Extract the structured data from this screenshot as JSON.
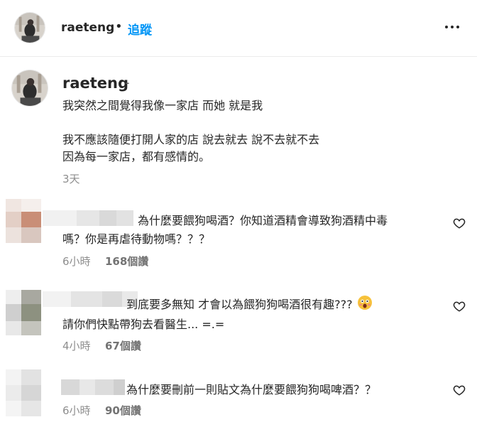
{
  "header": {
    "username": "raeteng",
    "separator": "•",
    "follow_label": "追蹤"
  },
  "post": {
    "username": "raeteng",
    "suffix": "-",
    "caption_lines": [
      "我突然之間覺得我像一家店 而她 就是我",
      "我不應該隨便打開人家的店 說去就去 說不去就不去",
      "因為每一家店，都有感情的。"
    ],
    "time": "3天"
  },
  "comments": [
    {
      "text_lines": [
        "為什麼要餵狗喝酒？你知道酒精會導致狗酒精中毒",
        "嗎？你是再虐待動物嗎？？？"
      ],
      "time": "6小時",
      "likes": "168個讚"
    },
    {
      "text_lines": [
        "到底要多無知 才會以為餵狗狗喝酒很有趣???",
        "請你們快點帶狗去看醫生... =.="
      ],
      "emoji": "scared-face-emoji",
      "time": "4小時",
      "likes": "67個讚"
    },
    {
      "text_lines": [
        "為什麼要刪前一則貼文為什麼要餵狗狗喝啤酒？？"
      ],
      "time": "6小時",
      "likes": "90個讚"
    }
  ],
  "icons": {
    "more": "more-horizontal-icon",
    "like": "heart-outline-icon"
  },
  "colors": {
    "follow": "#0095f6",
    "meta": "#8e8e8e"
  }
}
